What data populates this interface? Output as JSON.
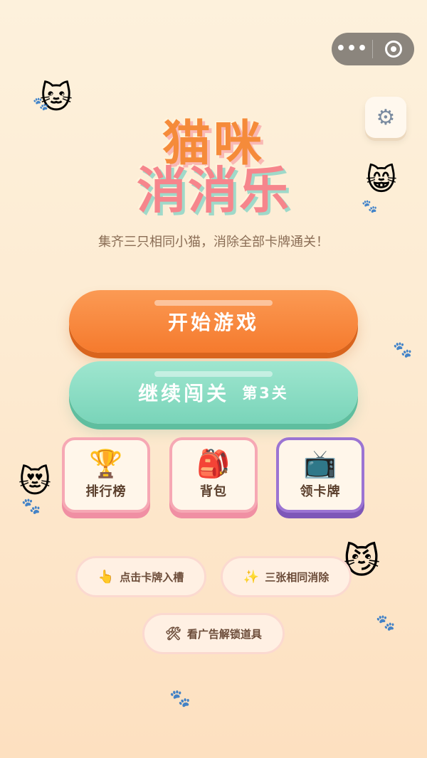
{
  "capsule": {
    "more": "•••",
    "close": "◎"
  },
  "settings": {
    "icon": "⚙"
  },
  "title": {
    "line1": "猫咪",
    "line2": "消消乐"
  },
  "subtitle": "集齐三只相同小猫，消除全部卡牌通关！",
  "buttons": {
    "start": "开始游戏",
    "continue": "继续闯关",
    "continue_level": "第3关"
  },
  "cards": [
    {
      "icon": "🏆",
      "label": "排行榜"
    },
    {
      "icon": "🎒",
      "label": "背包"
    },
    {
      "icon": "📺",
      "label": "领卡牌"
    }
  ],
  "hints": [
    {
      "icon": "👆",
      "label": "点击卡牌入槽"
    },
    {
      "icon": "✨",
      "label": "三张相同消除"
    },
    {
      "icon": "🛠",
      "label": "看广告解锁道具"
    }
  ],
  "decor": {
    "cat1": "🐱",
    "cat2": "😸",
    "cat3": "😻",
    "cat4": "😼",
    "paw": "🐾"
  },
  "colors": {
    "start_button": "#f57a2d",
    "continue_button": "#79d4b9",
    "pink_card_border": "#f6a8b4",
    "purple_card_border": "#9b74d3"
  }
}
